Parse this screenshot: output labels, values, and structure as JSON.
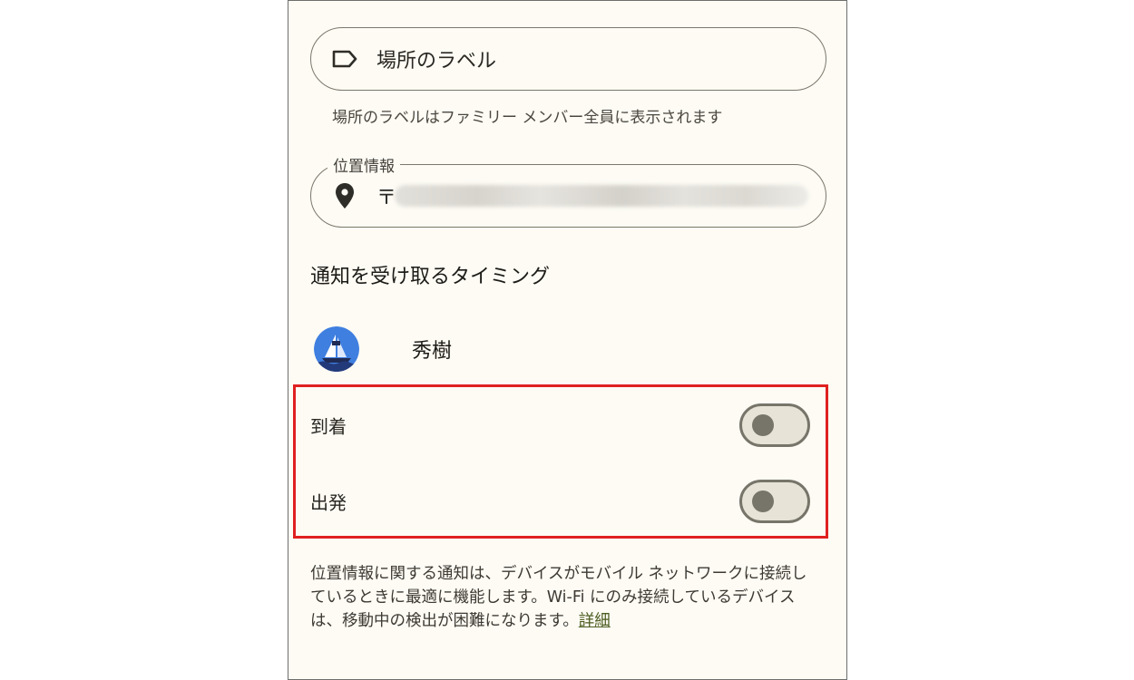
{
  "place_label": {
    "placeholder": "場所のラベル",
    "icon": "label-tag-icon",
    "helper": "場所のラベルはファミリー メンバー全員に表示されます"
  },
  "location": {
    "floating_label": "位置情報",
    "value_prefix": "〒",
    "icon": "location-pin-icon"
  },
  "notify": {
    "title": "通知を受け取るタイミング",
    "member_name": "秀樹",
    "arrival_label": "到着",
    "arrival_on": false,
    "departure_label": "出発",
    "departure_on": false
  },
  "footnote": {
    "line1": "位置情報に関する通知は、デバイスがモバイル ネットワークに接続し",
    "line2": "ているときに最適に機能します。Wi-Fi にのみ接続しているデバイス",
    "line3": "は、移動中の検出が困難になります。",
    "link": "詳細"
  },
  "colors": {
    "background": "#fdfbf4",
    "highlight": "#e02020",
    "link": "#4b5c20"
  }
}
